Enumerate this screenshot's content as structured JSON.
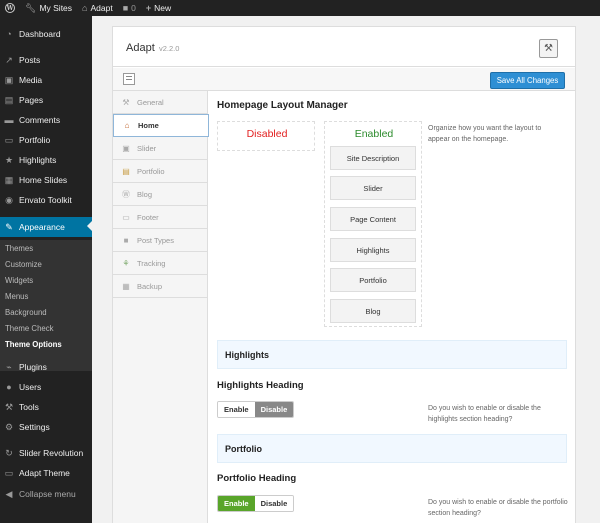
{
  "admin_bar": {
    "my_sites": "My Sites",
    "site_name": "Adapt",
    "comments_count": "0",
    "new_label": "New"
  },
  "sidebar": {
    "items": [
      {
        "label": "Dashboard",
        "icon": "dashboard-icon"
      },
      {
        "label": "Posts",
        "icon": "pin-icon"
      },
      {
        "label": "Media",
        "icon": "media-icon"
      },
      {
        "label": "Pages",
        "icon": "page-icon"
      },
      {
        "label": "Comments",
        "icon": "comment-icon"
      },
      {
        "label": "Portfolio",
        "icon": "folder-icon"
      },
      {
        "label": "Highlights",
        "icon": "star-icon"
      },
      {
        "label": "Home Slides",
        "icon": "slides-icon"
      },
      {
        "label": "Envato Toolkit",
        "icon": "toolkit-icon"
      },
      {
        "label": "Appearance",
        "icon": "brush-icon"
      },
      {
        "label": "Plugins",
        "icon": "plugin-icon"
      },
      {
        "label": "Users",
        "icon": "user-icon"
      },
      {
        "label": "Tools",
        "icon": "wrench-icon"
      },
      {
        "label": "Settings",
        "icon": "settings-icon"
      },
      {
        "label": "Slider Revolution",
        "icon": "refresh-icon"
      },
      {
        "label": "Adapt Theme",
        "icon": "monitor-icon"
      },
      {
        "label": "Collapse menu",
        "icon": "collapse-icon"
      }
    ],
    "submenu": [
      "Themes",
      "Customize",
      "Widgets",
      "Menus",
      "Background",
      "Theme Check",
      "Theme Options"
    ]
  },
  "panel": {
    "title": "Adapt",
    "version": "v2.2.0",
    "save_label": "Save All Changes"
  },
  "tabs": [
    {
      "label": "General",
      "icon": "wrench-icon"
    },
    {
      "label": "Home",
      "icon": "home-icon"
    },
    {
      "label": "Slider",
      "icon": "slider-icon"
    },
    {
      "label": "Portfolio",
      "icon": "portfolio-icon"
    },
    {
      "label": "Blog",
      "icon": "wordpress-icon"
    },
    {
      "label": "Footer",
      "icon": "footer-icon"
    },
    {
      "label": "Post Types",
      "icon": "post-types-icon"
    },
    {
      "label": "Tracking",
      "icon": "tracking-icon"
    },
    {
      "label": "Backup",
      "icon": "backup-icon"
    }
  ],
  "content": {
    "layout_title": "Homepage Layout Manager",
    "disabled_label": "Disabled",
    "enabled_label": "Enabled",
    "layout_desc": "Organize how you want the layout to appear on the homepage.",
    "blocks": [
      "Site Description",
      "Slider",
      "Page Content",
      "Highlights",
      "Portfolio",
      "Blog"
    ],
    "highlights_section": "Highlights",
    "highlights_heading": "Highlights Heading",
    "highlights_desc": "Do you wish to enable or disable the highlights section heading?",
    "portfolio_section": "Portfolio",
    "portfolio_heading": "Portfolio Heading",
    "portfolio_desc": "Do you wish to enable or disable the portfolio section heading?",
    "enable_label": "Enable",
    "disable_label": "Disable"
  },
  "colors": {
    "accent": "#0074a2",
    "save_button": "#2e8fd4",
    "disabled_red": "#e21f1f",
    "enabled_green": "#2b8a2b",
    "toggle_green": "#59a52a"
  }
}
